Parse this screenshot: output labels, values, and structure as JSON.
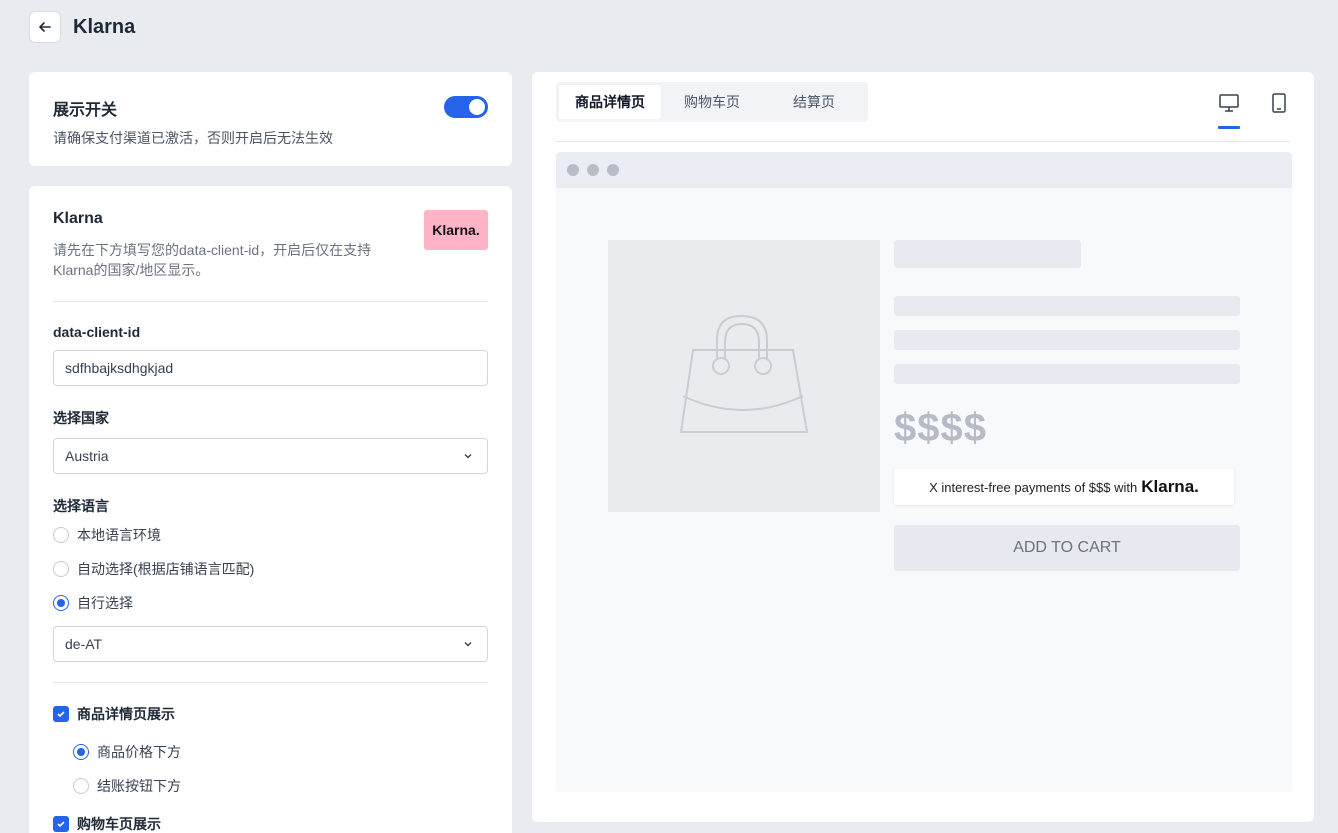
{
  "header": {
    "title": "Klarna",
    "back_icon": "arrow-left-icon"
  },
  "display_switch": {
    "title": "展示开关",
    "description": "请确保支付渠道已激活，否则开启后无法生效",
    "enabled": true
  },
  "klarna_card": {
    "title": "Klarna",
    "description": "请先在下方填写您的data-client-id，开启后仅在支持Klarna的国家/地区显示。",
    "logo_text": "Klarna.",
    "client_id_label": "data-client-id",
    "client_id_value": "sdfhbajksdhgkjad",
    "country_label": "选择国家",
    "country_value": "Austria",
    "language_label": "选择语言",
    "language_options": [
      "本地语言环境",
      "自动选择(根据店铺语言匹配)",
      "自行选择"
    ],
    "language_selected": "自行选择",
    "locale_value": "de-AT",
    "product_page_label": "商品详情页展示",
    "product_page_options": [
      "商品价格下方",
      "结账按钮下方"
    ],
    "product_page_selected": "商品价格下方",
    "cart_page_label": "购物车页展示"
  },
  "preview": {
    "tabs": [
      "商品详情页",
      "购物车页",
      "结算页"
    ],
    "active_tab": "商品详情页",
    "devices": [
      "desktop-icon",
      "mobile-icon"
    ],
    "active_device": "desktop-icon",
    "price_text": "$$$$",
    "klarna_message": "X interest-free payments of $$$ with",
    "klarna_brand": "Klarna.",
    "add_to_cart": "ADD TO CART"
  },
  "colors": {
    "accent": "#2563eb",
    "klarna_pink": "#ffb3c7",
    "background": "#e8ebf0"
  }
}
